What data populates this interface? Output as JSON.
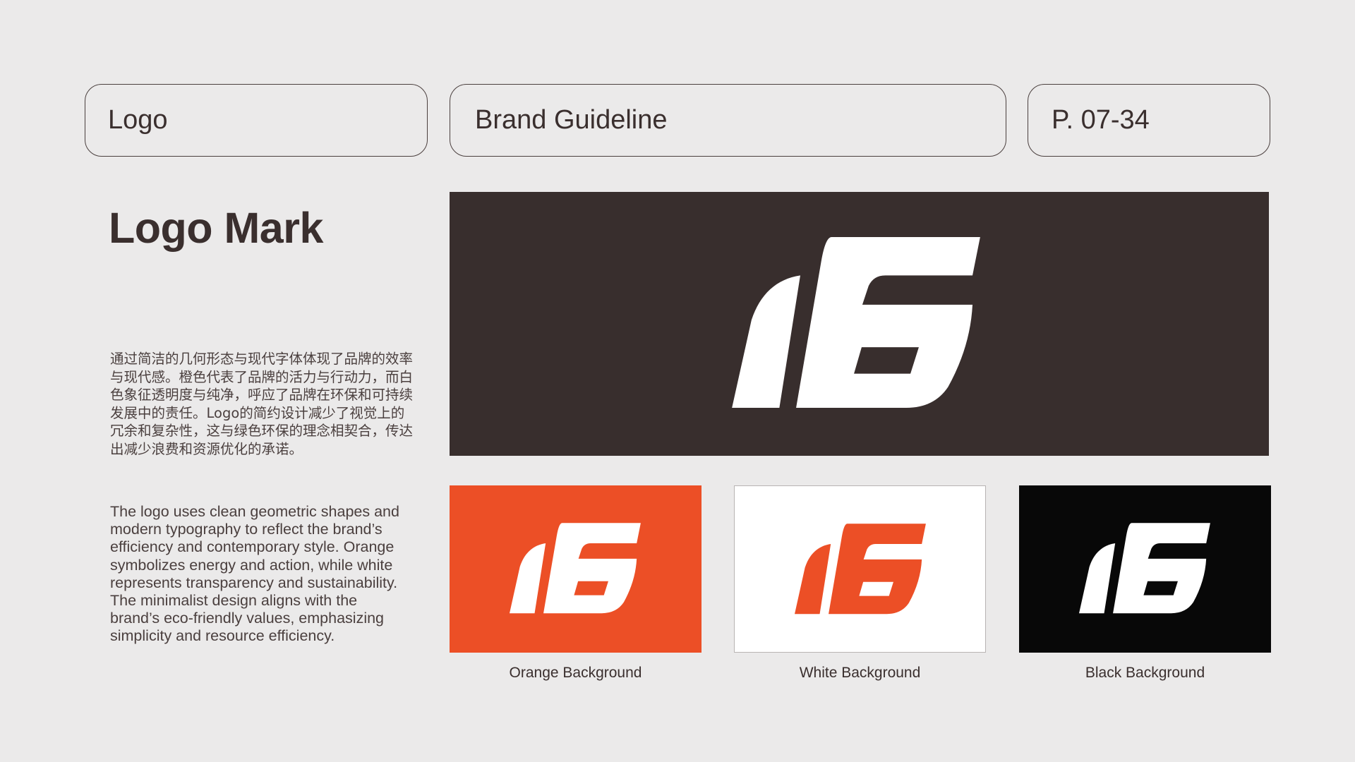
{
  "header": {
    "section": "Logo",
    "document_title": "Brand Guideline",
    "page_range": "P. 07-34"
  },
  "main": {
    "heading": "Logo Mark",
    "description_zh": "通过简洁的几何形态与现代字体体现了品牌的效率与现代感。橙色代表了品牌的活力与行动力，而白色象征透明度与纯净，呼应了品牌在环保和可持续发展中的责任。Logo的简约设计减少了视觉上的冗余和复杂性，这与绿色环保的理念相契合，传达出减少浪费和资源优化的承诺。",
    "description_en": "The logo uses clean geometric shapes and modern typography to reflect the brand’s efficiency and contemporary style. Orange symbolizes energy and action, while white represents transparency and sustainability. The minimalist design aligns with the brand’s eco-friendly values, emphasizing simplicity and resource efficiency."
  },
  "hero": {
    "background": "#382e2d",
    "logo_color": "#ffffff"
  },
  "variants": [
    {
      "caption": "Orange Background",
      "background": "#ec4f26",
      "logo_color": "#ffffff"
    },
    {
      "caption": "White Background",
      "background": "#ffffff",
      "logo_color": "#ec4f26"
    },
    {
      "caption": "Black Background",
      "background": "#080808",
      "logo_color": "#ffffff"
    }
  ],
  "colors": {
    "page_background": "#ebeaea",
    "text": "#3a2f2e",
    "accent": "#ec4f26"
  }
}
